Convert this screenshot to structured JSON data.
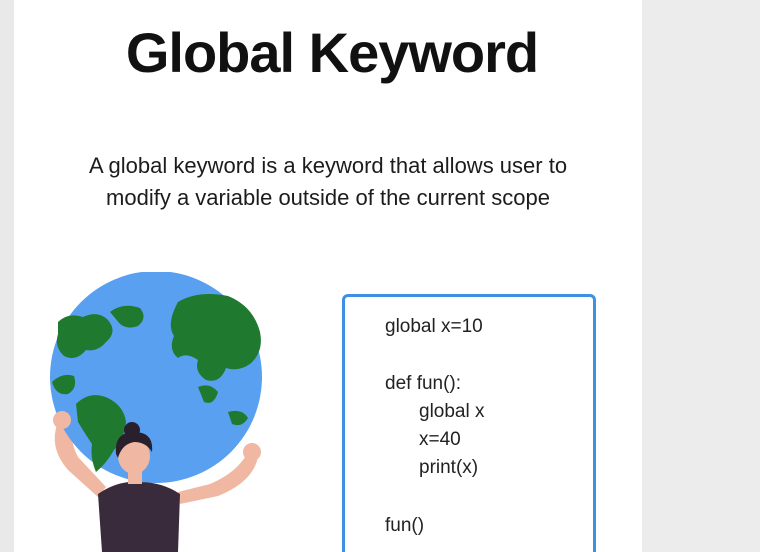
{
  "slide": {
    "title": "Global Keyword",
    "description_line1": "A global keyword is a keyword that allows user to",
    "description_line2": "modify a variable outside of the current scope"
  },
  "code": {
    "lines": [
      "global x=10",
      "",
      "def fun():",
      "global x",
      "x=40",
      "print(x)",
      "",
      "fun()"
    ]
  },
  "colors": {
    "accent_border": "#3f8fe3",
    "ocean": "#5aa0f0",
    "land": "#1f7a2f",
    "figure_body": "#3a2b3c"
  },
  "icons": {
    "illustration": "person-holding-globe-illustration"
  }
}
